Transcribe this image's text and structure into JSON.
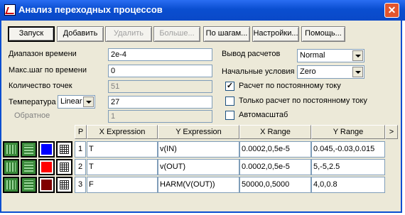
{
  "window": {
    "title": "Анализ переходных процессов",
    "close": "✕"
  },
  "toolbar": {
    "run": "Запуск",
    "add": "Добавить",
    "remove": "Удалить",
    "more": "Больше...",
    "steps": "По шагам...",
    "settings": "Настройки...",
    "help": "Помощь..."
  },
  "params": {
    "time_range": {
      "label": "Диапазон времени",
      "value": "2e-4"
    },
    "max_step": {
      "label": "Макс.шаг по времени",
      "value": "0"
    },
    "num_points": {
      "label": "Количество точек",
      "value": "51"
    },
    "temperature": {
      "label": "Температура",
      "mode": "Linear",
      "value": "27"
    },
    "reverse": {
      "label": "Обратное",
      "value": "1"
    }
  },
  "options": {
    "output": {
      "label": "Вывод расчетов",
      "value": "Normal"
    },
    "initial": {
      "label": "Начальные условия",
      "value": "Zero"
    },
    "dc_calc": {
      "label": "Расчет по постоянному току",
      "checked": true
    },
    "dc_only": {
      "label": "Только расчет по постоянному току",
      "checked": false
    },
    "autoscale": {
      "label": "Автомасштаб",
      "checked": false
    }
  },
  "table": {
    "headers": [
      "P",
      "X Expression",
      "Y Expression",
      "X Range",
      "Y Range",
      ">"
    ],
    "rows": [
      {
        "p": "1",
        "x": "T",
        "y": "v(IN)",
        "xr": "0.0002,0,5e-5",
        "yr": "0.045,-0.03,0.015",
        "color": "#0000ff"
      },
      {
        "p": "2",
        "x": "T",
        "y": "v(OUT)",
        "xr": "0.0002,0,5e-5",
        "yr": "5,-5,2.5",
        "color": "#ff0000"
      },
      {
        "p": "3",
        "x": "F",
        "y": "HARM(V(OUT))",
        "xr": "50000,0,5000",
        "yr": "4,0,0.8",
        "color": "#800000"
      }
    ]
  }
}
